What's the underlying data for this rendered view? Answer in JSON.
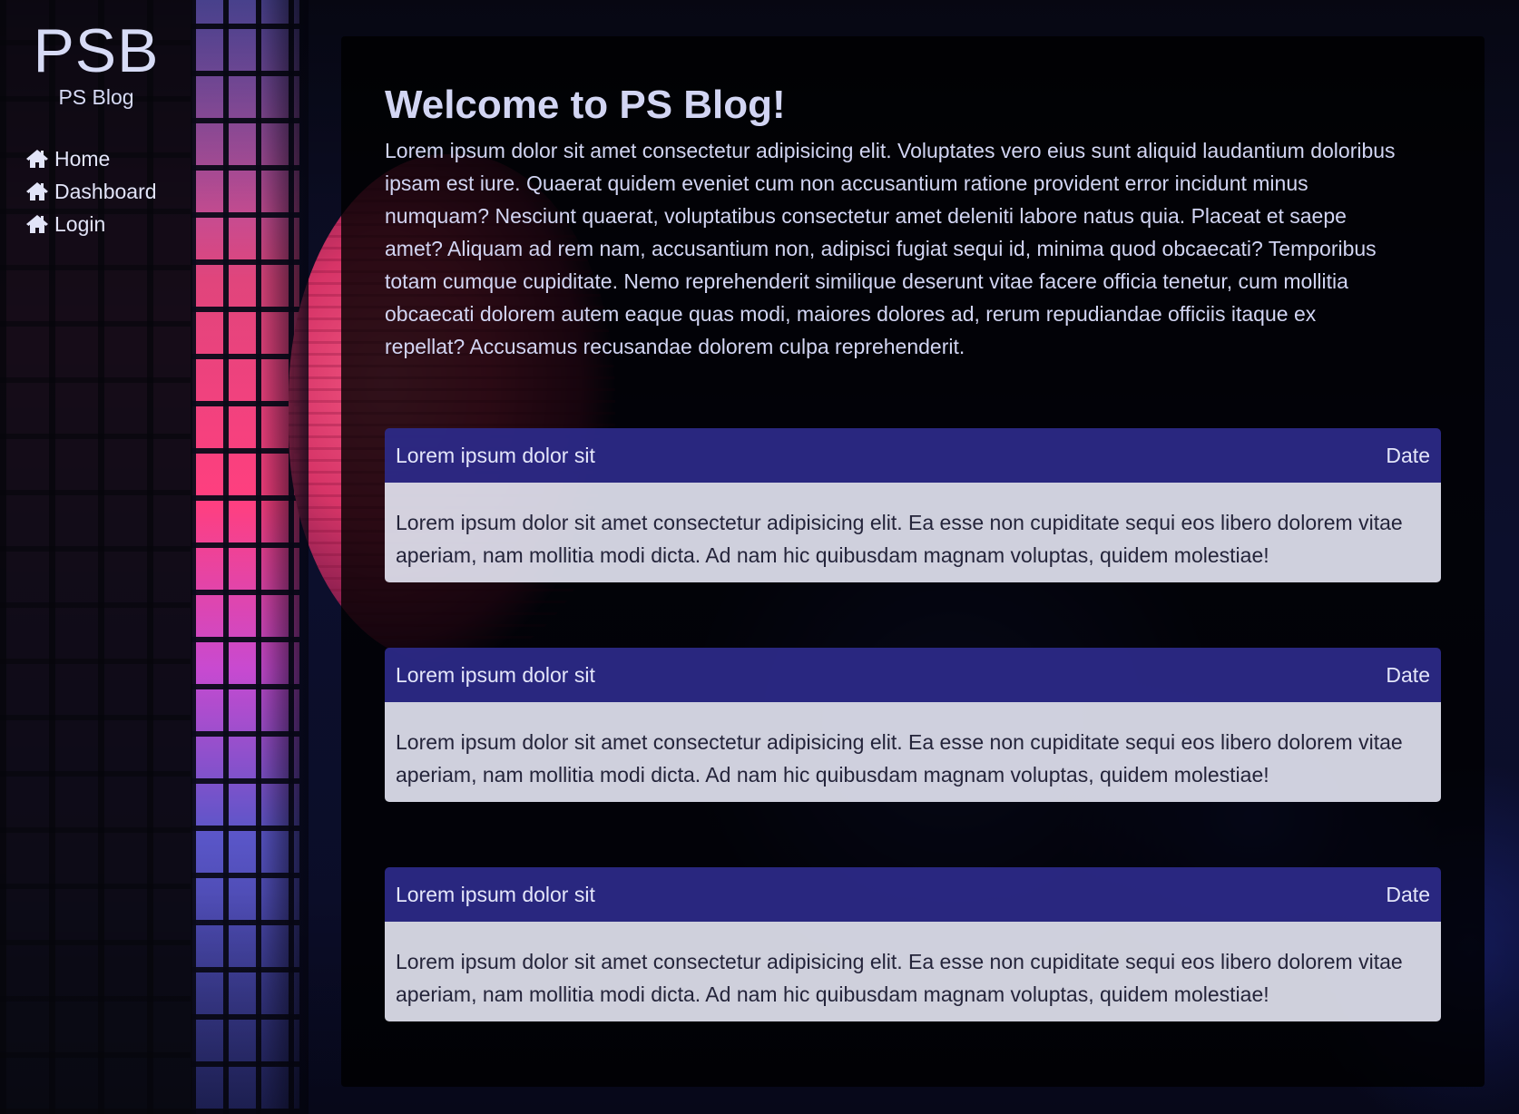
{
  "sidebar": {
    "logo": "PSB",
    "brand_name": "PS Blog",
    "nav_items": [
      {
        "label": "Home",
        "icon": "home-icon"
      },
      {
        "label": "Dashboard",
        "icon": "home-icon"
      },
      {
        "label": "Login",
        "icon": "home-icon"
      }
    ]
  },
  "main": {
    "title": "Welcome to PS Blog!",
    "intro": "Lorem ipsum dolor sit amet consectetur adipisicing elit. Voluptates vero eius sunt aliquid laudantium doloribus ipsam est iure. Quaerat quidem eveniet cum non accusantium ratione provident error incidunt minus numquam? Nesciunt quaerat, voluptatibus consectetur amet deleniti labore natus quia. Placeat et saepe amet? Aliquam ad rem nam, accusantium non, adipisci fugiat sequi id, minima quod obcaecati? Temporibus totam cumque cupiditate. Nemo reprehenderit similique deserunt vitae facere officia tenetur, cum mollitia obcaecati dolorem autem eaque quas modi, maiores dolores ad, rerum repudiandae officiis itaque ex repellat? Accusamus recusandae dolorem culpa reprehenderit.",
    "posts": [
      {
        "title": "Lorem ipsum dolor sit",
        "date": "Date",
        "body": "Lorem ipsum dolor sit amet consectetur adipisicing elit. Ea esse non cupiditate sequi eos libero dolorem vitae aperiam, nam mollitia modi dicta. Ad nam hic quibusdam magnam voluptas, quidem molestiae!"
      },
      {
        "title": "Lorem ipsum dolor sit",
        "date": "Date",
        "body": "Lorem ipsum dolor sit amet consectetur adipisicing elit. Ea esse non cupiditate sequi eos libero dolorem vitae aperiam, nam mollitia modi dicta. Ad nam hic quibusdam magnam voluptas, quidem molestiae!"
      },
      {
        "title": "Lorem ipsum dolor sit",
        "date": "Date",
        "body": "Lorem ipsum dolor sit amet consectetur adipisicing elit. Ea esse non cupiditate sequi eos libero dolorem vitae aperiam, nam mollitia modi dicta. Ad nam hic quibusdam magnam voluptas, quidem molestiae!"
      }
    ]
  },
  "colors": {
    "post_header_bg": "#2c2a8a",
    "post_body_bg": "#ecedfa",
    "text_light": "#d2d5f3",
    "panel_bg": "#000000"
  }
}
